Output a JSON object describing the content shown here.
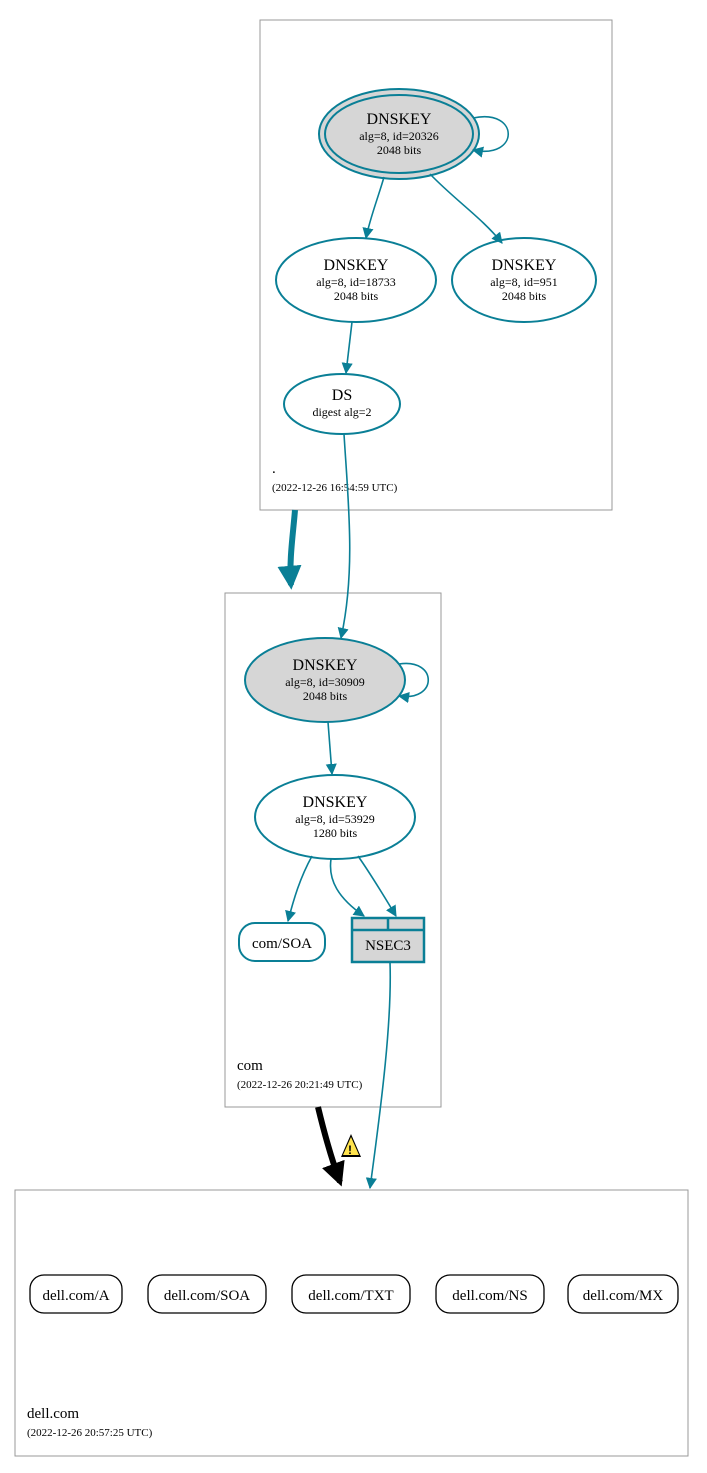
{
  "zones": {
    "root": {
      "name": ".",
      "timestamp": "(2022-12-26 16:54:59 UTC)"
    },
    "com": {
      "name": "com",
      "timestamp": "(2022-12-26 20:21:49 UTC)"
    },
    "dell": {
      "name": "dell.com",
      "timestamp": "(2022-12-26 20:57:25 UTC)"
    }
  },
  "nodes": {
    "root_ksk": {
      "title": "DNSKEY",
      "line2": "alg=8, id=20326",
      "line3": "2048 bits"
    },
    "root_zsk1": {
      "title": "DNSKEY",
      "line2": "alg=8, id=18733",
      "line3": "2048 bits"
    },
    "root_zsk2": {
      "title": "DNSKEY",
      "line2": "alg=8, id=951",
      "line3": "2048 bits"
    },
    "root_ds": {
      "title": "DS",
      "line2": "digest alg=2"
    },
    "com_ksk": {
      "title": "DNSKEY",
      "line2": "alg=8, id=30909",
      "line3": "2048 bits"
    },
    "com_zsk": {
      "title": "DNSKEY",
      "line2": "alg=8, id=53929",
      "line3": "1280 bits"
    },
    "com_soa": {
      "label": "com/SOA"
    },
    "com_nsec": {
      "label": "NSEC3"
    },
    "rr_a": {
      "label": "dell.com/A"
    },
    "rr_soa": {
      "label": "dell.com/SOA"
    },
    "rr_txt": {
      "label": "dell.com/TXT"
    },
    "rr_ns": {
      "label": "dell.com/NS"
    },
    "rr_mx": {
      "label": "dell.com/MX"
    }
  }
}
